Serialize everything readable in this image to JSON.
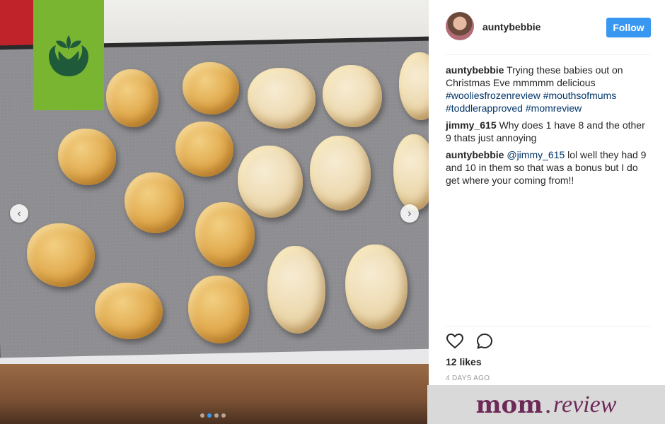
{
  "post": {
    "username": "auntybebbie",
    "follow_label": "Follow",
    "likes": "12 likes",
    "time": "4 DAYS AGO"
  },
  "comments": [
    {
      "user": "auntybebbie",
      "text": "Trying these babies out on Christmas Eve mmmmm delicious",
      "tags": [
        "#wooliesfrozenreview",
        "#mouthsofmums",
        "#toddlerapproved",
        "#momreview"
      ]
    },
    {
      "user": "jimmy_615",
      "text": "Why does 1 have 8 and the other 9 thats just annoying"
    },
    {
      "user": "auntybebbie",
      "mention": "@jimmy_615",
      "text": "lol well they had 9 and 10 in them so that was a bonus but I do get where your coming from!!"
    }
  ],
  "carousel": {
    "prev_icon": "chevron-left-icon",
    "next_icon": "chevron-right-icon",
    "slide_count": 4,
    "active_slide": 2
  },
  "icons": {
    "like": "heart-icon",
    "comment": "comment-icon",
    "logo": "woolworths-logo"
  },
  "banner": {
    "brand_a": "mom",
    "brand_b": "review"
  },
  "colors": {
    "follow": "#3897f0",
    "hashtag": "#003569",
    "logo_green": "#7ab532",
    "brand": "#6d2a58"
  }
}
